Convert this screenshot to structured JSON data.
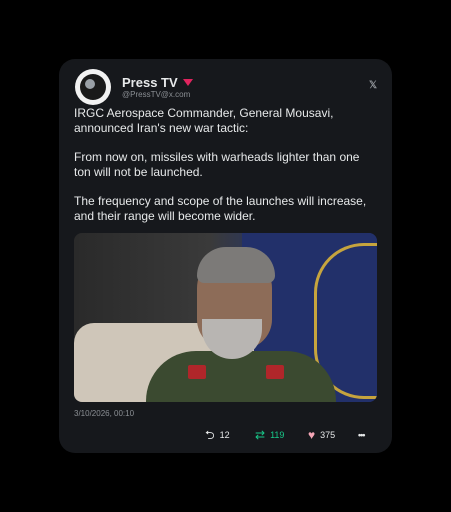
{
  "post": {
    "author_name": "Press TV",
    "author_handle": "@PressTV@x.com",
    "platform_icon": "x-logo",
    "paragraphs": [
      "IRGC Aerospace Commander, General Mousavi, announced Iran's new war tactic:",
      "From now on, missiles with warheads lighter than one ton will not be launched.",
      "The frequency and scope of the launches will increase, and their range will become wider."
    ],
    "timestamp": "3/10/2026, 00:10",
    "stats": {
      "replies": "12",
      "retweets": "119",
      "likes": "375"
    },
    "colors": {
      "retweet": "#18c98a",
      "like": "#f4a5b5",
      "flag": "#e0245e"
    }
  }
}
